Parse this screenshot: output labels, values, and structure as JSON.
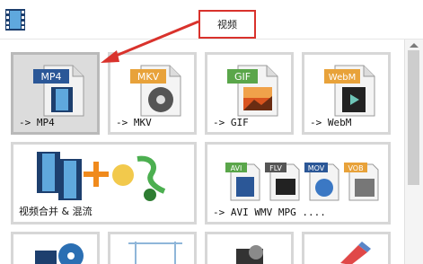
{
  "header": {
    "title": "视频",
    "app_icon": "film-strip-icon"
  },
  "tiles": [
    {
      "label": "-> MP4",
      "badge": "MP4",
      "badge_color": "#2b5797",
      "icon": "mp4-file-icon"
    },
    {
      "label": "-> MKV",
      "badge": "MKV",
      "badge_color": "#e8a23a",
      "icon": "mkv-file-icon"
    },
    {
      "label": "-> GIF",
      "badge": "GIF",
      "badge_color": "#5aa64a",
      "icon": "gif-file-icon"
    },
    {
      "label": "-> WebM",
      "badge": "WebM",
      "badge_color": "#e8a23a",
      "icon": "webm-file-icon"
    },
    {
      "label": "视频合并 & 混流",
      "icon": "merge-music-icon"
    },
    {
      "label": "-> AVI WMV MPG ....",
      "badges": [
        "AVI",
        "FLV",
        "MOV",
        "VOB"
      ],
      "icon": "multi-format-icon"
    }
  ],
  "colors": {
    "accent_red": "#d9322c",
    "selected_bg": "#dcdcdc"
  }
}
